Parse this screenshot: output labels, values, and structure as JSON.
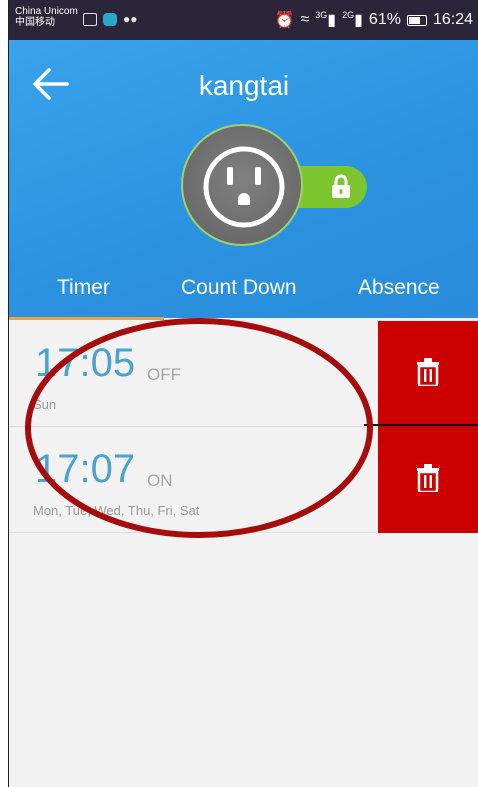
{
  "status_bar": {
    "carrier_line1": "China Unicom",
    "carrier_line2": "中国移动",
    "signal1_label": "3G",
    "signal2_label": "2G",
    "battery": "61%",
    "time": "16:24"
  },
  "header": {
    "title": "kangtai",
    "tabs": [
      {
        "label": "Timer"
      },
      {
        "label": "Count Down"
      },
      {
        "label": "Absence"
      }
    ],
    "colors": {
      "header_bg": "#2b93e0",
      "lock_pill": "#7cc52e",
      "tab_indicator": "#e8a24a"
    }
  },
  "timers": [
    {
      "time": "17:05",
      "state": "OFF",
      "days": "Sun"
    },
    {
      "time": "17:07",
      "state": "ON",
      "days": "Mon, Tue, Wed, Thu, Fri, Sat"
    }
  ],
  "icons": {
    "back": "arrow-left-icon",
    "lock": "lock-icon",
    "plug": "power-outlet-icon",
    "delete": "trash-icon"
  },
  "colors": {
    "delete_bg": "#cc0000",
    "time_text": "#4aa3cf",
    "annotation": "#a50d0d"
  }
}
